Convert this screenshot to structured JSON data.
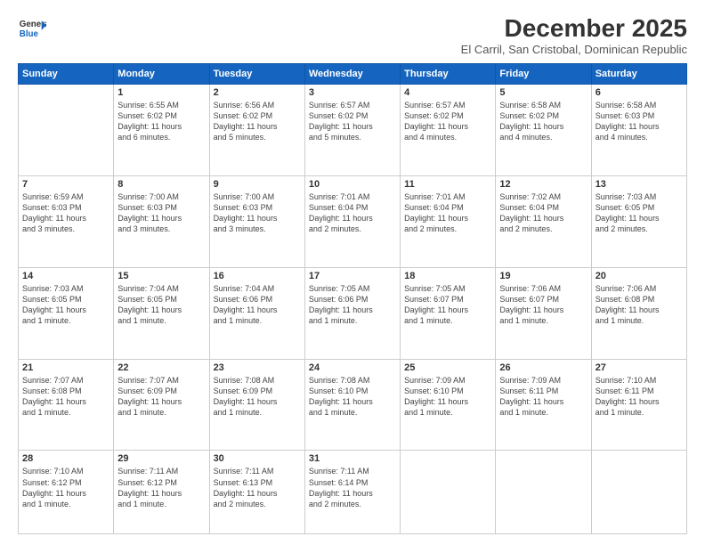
{
  "logo": {
    "line1": "General",
    "line2": "Blue"
  },
  "title": "December 2025",
  "location": "El Carril, San Cristobal, Dominican Republic",
  "weekdays": [
    "Sunday",
    "Monday",
    "Tuesday",
    "Wednesday",
    "Thursday",
    "Friday",
    "Saturday"
  ],
  "weeks": [
    [
      {
        "num": "",
        "info": ""
      },
      {
        "num": "1",
        "info": "Sunrise: 6:55 AM\nSunset: 6:02 PM\nDaylight: 11 hours\nand 6 minutes."
      },
      {
        "num": "2",
        "info": "Sunrise: 6:56 AM\nSunset: 6:02 PM\nDaylight: 11 hours\nand 5 minutes."
      },
      {
        "num": "3",
        "info": "Sunrise: 6:57 AM\nSunset: 6:02 PM\nDaylight: 11 hours\nand 5 minutes."
      },
      {
        "num": "4",
        "info": "Sunrise: 6:57 AM\nSunset: 6:02 PM\nDaylight: 11 hours\nand 4 minutes."
      },
      {
        "num": "5",
        "info": "Sunrise: 6:58 AM\nSunset: 6:02 PM\nDaylight: 11 hours\nand 4 minutes."
      },
      {
        "num": "6",
        "info": "Sunrise: 6:58 AM\nSunset: 6:03 PM\nDaylight: 11 hours\nand 4 minutes."
      }
    ],
    [
      {
        "num": "7",
        "info": "Sunrise: 6:59 AM\nSunset: 6:03 PM\nDaylight: 11 hours\nand 3 minutes."
      },
      {
        "num": "8",
        "info": "Sunrise: 7:00 AM\nSunset: 6:03 PM\nDaylight: 11 hours\nand 3 minutes."
      },
      {
        "num": "9",
        "info": "Sunrise: 7:00 AM\nSunset: 6:03 PM\nDaylight: 11 hours\nand 3 minutes."
      },
      {
        "num": "10",
        "info": "Sunrise: 7:01 AM\nSunset: 6:04 PM\nDaylight: 11 hours\nand 2 minutes."
      },
      {
        "num": "11",
        "info": "Sunrise: 7:01 AM\nSunset: 6:04 PM\nDaylight: 11 hours\nand 2 minutes."
      },
      {
        "num": "12",
        "info": "Sunrise: 7:02 AM\nSunset: 6:04 PM\nDaylight: 11 hours\nand 2 minutes."
      },
      {
        "num": "13",
        "info": "Sunrise: 7:03 AM\nSunset: 6:05 PM\nDaylight: 11 hours\nand 2 minutes."
      }
    ],
    [
      {
        "num": "14",
        "info": "Sunrise: 7:03 AM\nSunset: 6:05 PM\nDaylight: 11 hours\nand 1 minute."
      },
      {
        "num": "15",
        "info": "Sunrise: 7:04 AM\nSunset: 6:05 PM\nDaylight: 11 hours\nand 1 minute."
      },
      {
        "num": "16",
        "info": "Sunrise: 7:04 AM\nSunset: 6:06 PM\nDaylight: 11 hours\nand 1 minute."
      },
      {
        "num": "17",
        "info": "Sunrise: 7:05 AM\nSunset: 6:06 PM\nDaylight: 11 hours\nand 1 minute."
      },
      {
        "num": "18",
        "info": "Sunrise: 7:05 AM\nSunset: 6:07 PM\nDaylight: 11 hours\nand 1 minute."
      },
      {
        "num": "19",
        "info": "Sunrise: 7:06 AM\nSunset: 6:07 PM\nDaylight: 11 hours\nand 1 minute."
      },
      {
        "num": "20",
        "info": "Sunrise: 7:06 AM\nSunset: 6:08 PM\nDaylight: 11 hours\nand 1 minute."
      }
    ],
    [
      {
        "num": "21",
        "info": "Sunrise: 7:07 AM\nSunset: 6:08 PM\nDaylight: 11 hours\nand 1 minute."
      },
      {
        "num": "22",
        "info": "Sunrise: 7:07 AM\nSunset: 6:09 PM\nDaylight: 11 hours\nand 1 minute."
      },
      {
        "num": "23",
        "info": "Sunrise: 7:08 AM\nSunset: 6:09 PM\nDaylight: 11 hours\nand 1 minute."
      },
      {
        "num": "24",
        "info": "Sunrise: 7:08 AM\nSunset: 6:10 PM\nDaylight: 11 hours\nand 1 minute."
      },
      {
        "num": "25",
        "info": "Sunrise: 7:09 AM\nSunset: 6:10 PM\nDaylight: 11 hours\nand 1 minute."
      },
      {
        "num": "26",
        "info": "Sunrise: 7:09 AM\nSunset: 6:11 PM\nDaylight: 11 hours\nand 1 minute."
      },
      {
        "num": "27",
        "info": "Sunrise: 7:10 AM\nSunset: 6:11 PM\nDaylight: 11 hours\nand 1 minute."
      }
    ],
    [
      {
        "num": "28",
        "info": "Sunrise: 7:10 AM\nSunset: 6:12 PM\nDaylight: 11 hours\nand 1 minute."
      },
      {
        "num": "29",
        "info": "Sunrise: 7:11 AM\nSunset: 6:12 PM\nDaylight: 11 hours\nand 1 minute."
      },
      {
        "num": "30",
        "info": "Sunrise: 7:11 AM\nSunset: 6:13 PM\nDaylight: 11 hours\nand 2 minutes."
      },
      {
        "num": "31",
        "info": "Sunrise: 7:11 AM\nSunset: 6:14 PM\nDaylight: 11 hours\nand 2 minutes."
      },
      {
        "num": "",
        "info": ""
      },
      {
        "num": "",
        "info": ""
      },
      {
        "num": "",
        "info": ""
      }
    ]
  ]
}
